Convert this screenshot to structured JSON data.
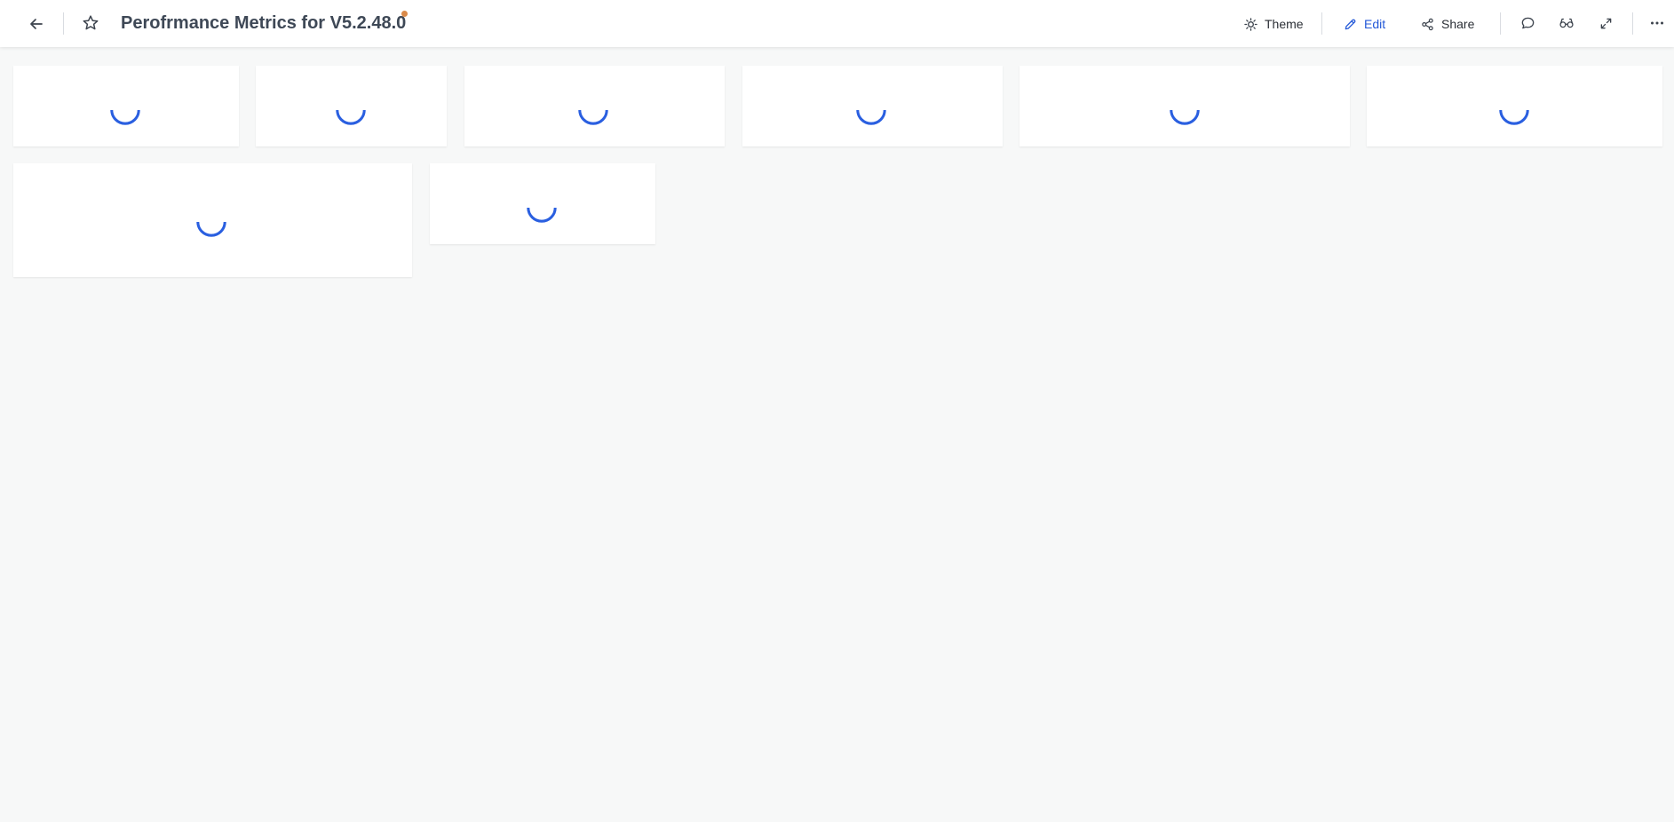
{
  "header": {
    "title": "Perofrmance Metrics for V5.2.48.0",
    "unsaved_dot_color": "#d98a4a",
    "back_icon": "arrow-left-icon",
    "favorite_icon": "star-outline-icon",
    "theme_label": "Theme",
    "theme_icon": "sun-icon",
    "edit_label": "Edit",
    "edit_icon": "pencil-icon",
    "edit_color": "#2459d8",
    "share_label": "Share",
    "share_icon": "share-nodes-icon",
    "comment_icon": "speech-bubble-icon",
    "viewers_icon": "glasses-icon",
    "fullscreen_icon": "expand-arrows-icon",
    "more_icon": "ellipsis-icon"
  },
  "tiles": {
    "state": "loading",
    "spinner_icon": "loading-spinner-icon",
    "spinner_color": "#2a5fe0",
    "count": 8
  }
}
